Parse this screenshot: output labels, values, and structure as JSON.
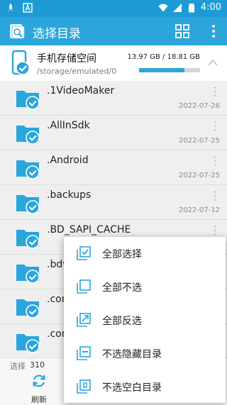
{
  "status_bar": {
    "time": "4:00"
  },
  "toolbar": {
    "title": "选择目录"
  },
  "storage": {
    "name": "手机存储空间",
    "path": "/storage/emulated/0",
    "size": "13.97 GB / 18.81 GB",
    "used_fraction": 0.74
  },
  "files": [
    {
      "name": ".1VideoMaker",
      "date": "2022-07-26"
    },
    {
      "name": ".AllInSdk",
      "date": "2022-07-25"
    },
    {
      "name": ".Android",
      "date": "2022-07-25"
    },
    {
      "name": ".backups",
      "date": "2022-07-12"
    },
    {
      "name": ".BD_SAPI_CACHE",
      "date": ""
    },
    {
      "name": ".bdw",
      "date": ""
    },
    {
      "name": ".com",
      "date": ""
    },
    {
      "name": ".com",
      "date": ""
    }
  ],
  "bottom": {
    "selected_label": "选择",
    "selected_count": "310",
    "refresh_label": "刷新"
  },
  "menu": [
    {
      "label": "全部选择",
      "icon": "select-all-icon"
    },
    {
      "label": "全部不选",
      "icon": "deselect-all-icon"
    },
    {
      "label": "全部反选",
      "icon": "invert-selection-icon"
    },
    {
      "label": "不选隐藏目录",
      "icon": "hidden-folder-icon"
    },
    {
      "label": "不选空白目录",
      "icon": "empty-folder-icon"
    }
  ],
  "colors": {
    "accent": "#2aa6dd",
    "status_bar": "#1e9bd4"
  }
}
